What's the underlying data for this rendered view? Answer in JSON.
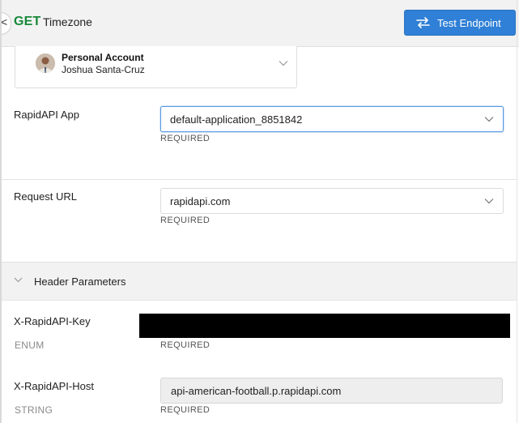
{
  "header": {
    "method": "GET",
    "endpoint_name": "Timezone",
    "collapse_glyph": "<",
    "test_button_label": "Test Endpoint",
    "test_button_icon": "swap-arrows-icon"
  },
  "account": {
    "type": "Personal Account",
    "name": "Joshua Santa-Cruz"
  },
  "app_field": {
    "label": "RapidAPI App",
    "value": "default-application_8851842",
    "required": "REQUIRED"
  },
  "url_field": {
    "label": "Request URL",
    "value": "rapidapi.com",
    "required": "REQUIRED"
  },
  "header_params": {
    "title": "Header Parameters",
    "key_param": {
      "label": "X-RapidAPI-Key",
      "type": "ENUM",
      "required": "REQUIRED"
    },
    "host_param": {
      "label": "X-RapidAPI-Host",
      "type": "STRING",
      "value": "api-american-football.p.rapidapi.com",
      "required": "REQUIRED"
    }
  },
  "colors": {
    "method_green": "#18883a",
    "primary_blue": "#2f80d6",
    "header_bg": "#f2f2f2"
  }
}
